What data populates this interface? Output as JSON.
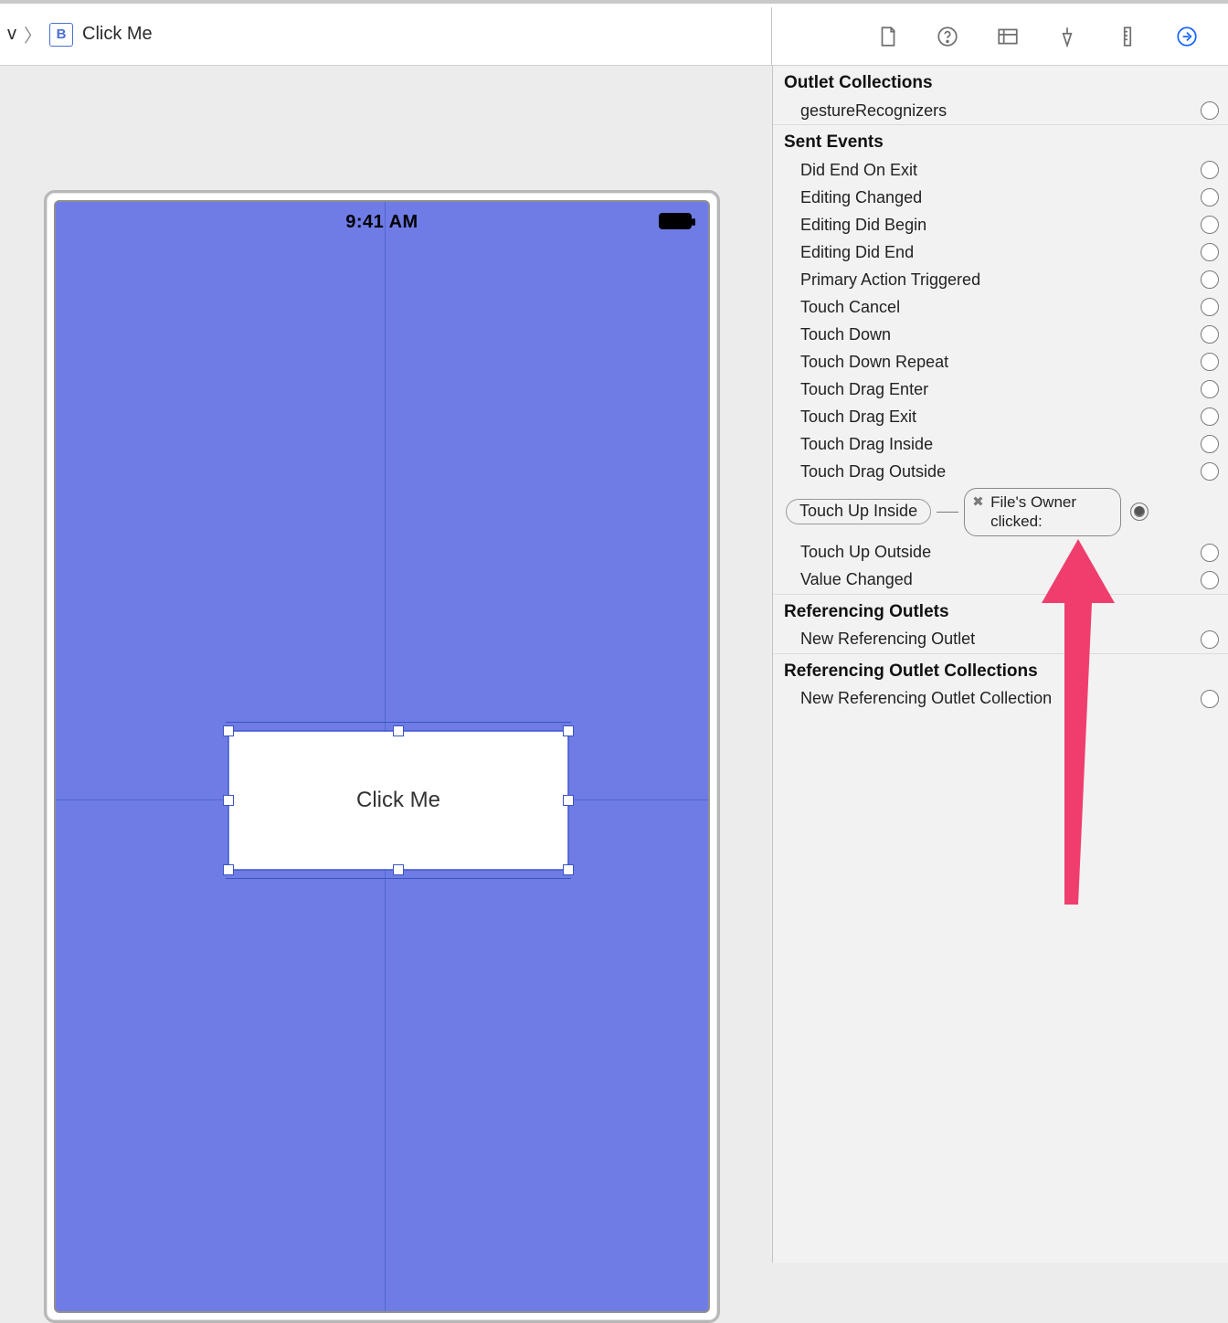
{
  "breadcrumb": {
    "prev_letter": "v",
    "badge": "B",
    "label": "Click Me"
  },
  "canvas": {
    "time": "9:41 AM",
    "selected_button_label": "Click Me"
  },
  "inspector": {
    "outlet_collections": {
      "title": "Outlet Collections",
      "items": [
        "gestureRecognizers"
      ]
    },
    "sent_events": {
      "title": "Sent Events",
      "items": [
        "Did End On Exit",
        "Editing Changed",
        "Editing Did Begin",
        "Editing Did End",
        "Primary Action Triggered",
        "Touch Cancel",
        "Touch Down",
        "Touch Down Repeat",
        "Touch Drag Enter",
        "Touch Drag Exit",
        "Touch Drag Inside",
        "Touch Drag Outside"
      ],
      "connected": {
        "event": "Touch Up Inside",
        "target": "File's Owner",
        "action": "clicked:"
      },
      "items_after": [
        "Touch Up Outside",
        "Value Changed"
      ]
    },
    "referencing_outlets": {
      "title": "Referencing Outlets",
      "items": [
        "New Referencing Outlet"
      ]
    },
    "referencing_outlet_collections": {
      "title": "Referencing Outlet Collections",
      "items": [
        "New Referencing Outlet Collection"
      ]
    }
  }
}
